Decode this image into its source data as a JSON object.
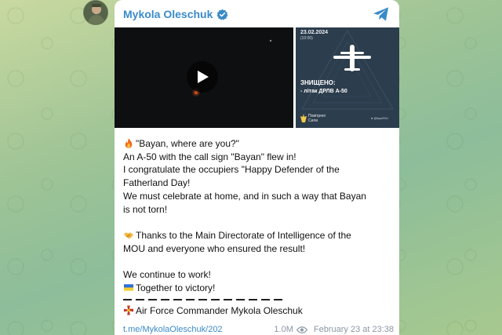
{
  "channel": {
    "name": "Mykola Oleschuk",
    "verified_icon": "verified-badge-icon",
    "telegram_icon": "telegram-icon",
    "accent_color": "#3a8bc9"
  },
  "media": {
    "video": {
      "play_icon": "play-icon"
    },
    "graphic": {
      "date": "23.02.2024",
      "time": "(10:00)",
      "headline": "ЗНИЩЕНО:",
      "subline": "- літак ДРЛВ А-50",
      "brand": [
        "Повітряні",
        "Сили"
      ],
      "tag": "● @kpsZSU"
    }
  },
  "message": {
    "lines": [
      "\"Bayan, where are you?\"",
      "An A-50 with the call sign \"Bayan\" flew in!",
      "I congratulate the occupiers \"Happy Defender of the",
      "Fatherland Day!",
      "We must celebrate at home, and in such a way that Bayan",
      "is not torn!"
    ],
    "thanks_lines": [
      "Thanks to the Main Directorate of Intelligence of the",
      "MOU and everyone who ensured the result!"
    ],
    "closing_lines": [
      "We continue to work!",
      "Together to victory!"
    ],
    "signature": "Air Force Commander Mykola Oleschuk"
  },
  "footer": {
    "link": "t.me/MykolaOleschuk/202",
    "views": "1.0M",
    "date": "February 23 at 23:38"
  }
}
